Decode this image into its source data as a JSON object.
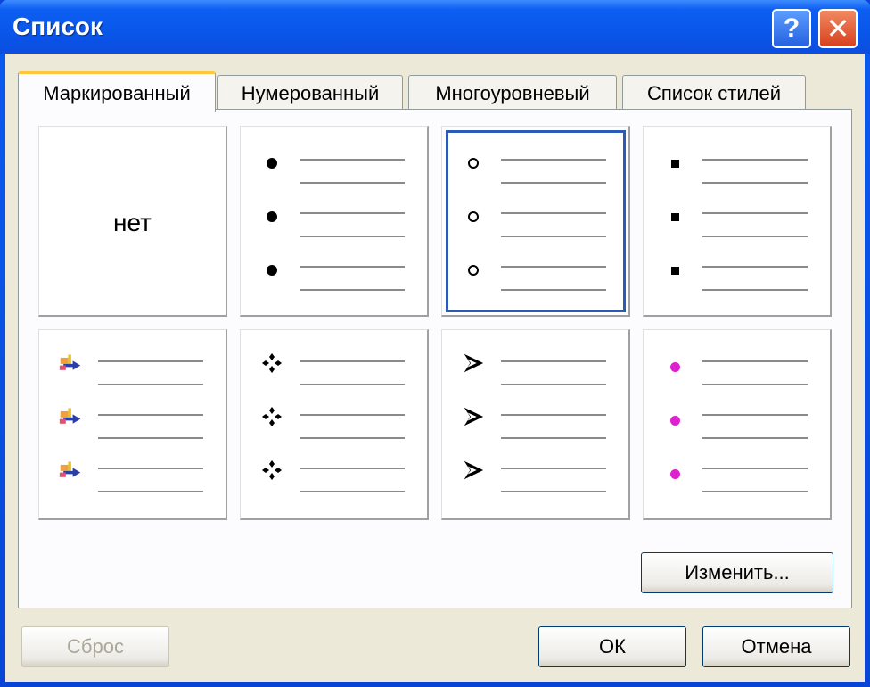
{
  "window": {
    "title": "Список"
  },
  "titlebar": {
    "help_label": "?",
    "close_label": "✕"
  },
  "tabs": [
    {
      "label": "Маркированный",
      "active": true
    },
    {
      "label": "Нумерованный",
      "active": false
    },
    {
      "label": "Многоуровневый",
      "active": false
    },
    {
      "label": "Список стилей",
      "active": false
    }
  ],
  "grid": {
    "none_label": "нет",
    "cells": [
      {
        "style": "none",
        "selected": false
      },
      {
        "style": "filled-dot",
        "selected": false
      },
      {
        "style": "hollow-circle",
        "selected": true
      },
      {
        "style": "square",
        "selected": false
      },
      {
        "style": "picture-icon",
        "selected": false
      },
      {
        "style": "four-diamonds",
        "selected": false
      },
      {
        "style": "arrowhead",
        "selected": false
      },
      {
        "style": "magenta-dot",
        "selected": false
      }
    ]
  },
  "buttons": {
    "modify": "Изменить...",
    "reset": "Сброс",
    "ok": "ОК",
    "cancel": "Отмена"
  },
  "colors": {
    "titlebar": "#0a56ea",
    "client_bg": "#ece9d8",
    "selection": "#2b5bb4",
    "magenta_bullet": "#e020d0"
  }
}
